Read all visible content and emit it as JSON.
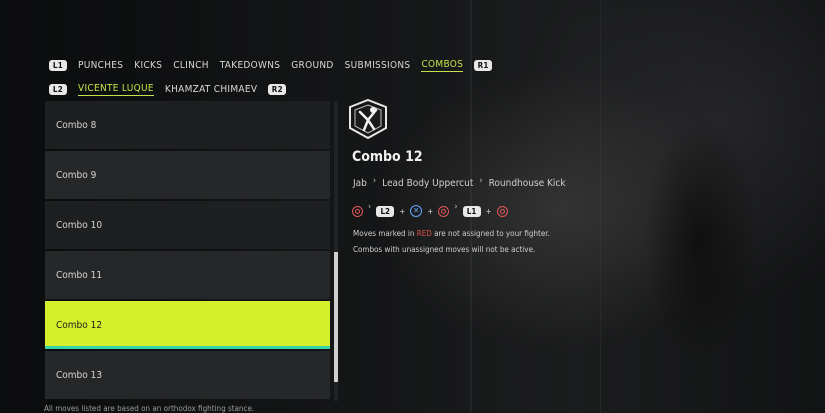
{
  "tabs": {
    "left_button": "L1",
    "right_button": "R1",
    "items": [
      "PUNCHES",
      "KICKS",
      "CLINCH",
      "TAKEDOWNS",
      "GROUND",
      "SUBMISSIONS",
      "COMBOS"
    ],
    "active_index": 6
  },
  "fighters": {
    "left_button": "L2",
    "right_button": "R2",
    "items": [
      "VICENTE LUQUE",
      "KHAMZAT CHIMAEV"
    ],
    "active_index": 0
  },
  "combos": {
    "items": [
      "Combo 8",
      "Combo 9",
      "Combo 10",
      "Combo 11",
      "Combo 12",
      "Combo 13"
    ],
    "selected_index": 4
  },
  "details": {
    "title": "Combo 12",
    "moves": [
      "Jab",
      "Lead Body Uppercut",
      "Roundhouse Kick"
    ],
    "inputs": {
      "l2": "L2",
      "l1": "L1",
      "plus": "+"
    },
    "note_line1_start": "Moves marked in ",
    "note_line1_red": "RED",
    "note_line1_end": " are not assigned to your fighter.",
    "note_line2": "Combos with unassigned moves will not be active."
  },
  "footer": {
    "note": "All moves listed are based on an orthodox fighting stance."
  },
  "colors": {
    "accent_lime": "#c6e24a",
    "selected_bg": "#d4f02d",
    "selected_underline": "#37d3a8",
    "red_mark": "#e0524b",
    "cross_blue": "#6ba6ff"
  },
  "icons": {
    "logo": "fighter-emblem-icon",
    "circle": "circle-button-icon",
    "cross": "cross-button-icon",
    "chevron": "chevron-right-icon"
  }
}
